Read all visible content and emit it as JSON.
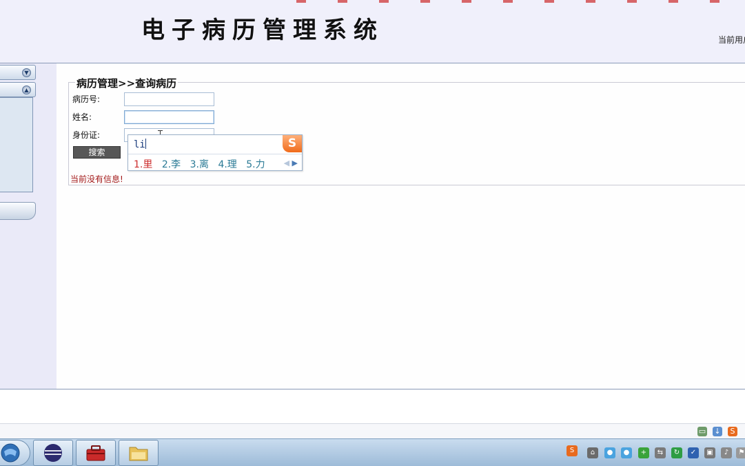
{
  "header": {
    "title": "电子病历管理系统",
    "current_user_label": "当前用户"
  },
  "form": {
    "legend": "病历管理>>查询病历",
    "fields": [
      {
        "label": "病历号:",
        "value": ""
      },
      {
        "label": "姓名:",
        "value": ""
      },
      {
        "label": "身份证:",
        "value": ""
      }
    ],
    "search_button": "搜索",
    "empty_message": "当前没有信息!"
  },
  "ime": {
    "typed": "li",
    "logo": "S",
    "candidates": [
      "1.里",
      "2.李",
      "3.离",
      "4.理",
      "5.力"
    ],
    "nav_prev": "◀",
    "nav_next": "▶"
  },
  "taskbar": {
    "buttons": [
      "start-orb-icon",
      "eclipse-icon",
      "toolbox-icon",
      "folder-icon"
    ],
    "tray_sogou": "S"
  },
  "colors": {
    "header_bg": "#f0f0fb",
    "sidebar_bg": "#eaeaf8",
    "message_red": "#a31a1a",
    "ime_first_candidate": "#cc2b2b",
    "ime_candidate": "#2a7a95"
  }
}
